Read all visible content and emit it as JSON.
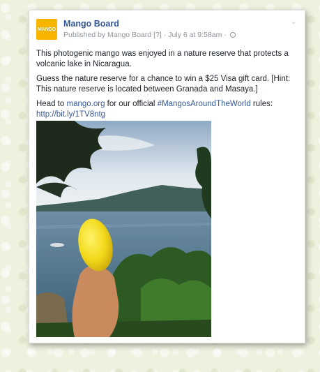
{
  "post": {
    "page_name": "Mango Board",
    "avatar_text": "MANGO",
    "published_by": "Published by Mango Board",
    "help_marker": "[?]",
    "separator": "·",
    "timestamp": "July 6 at 9:58am",
    "paragraph1": "This photogenic mango was enjoyed in a nature reserve that protects a volcanic lake in Nicaragua.",
    "paragraph2": "Guess the nature reserve for a chance to win a $25 Visa gift card. [Hint: This nature reserve is located between Granada and Masaya.]",
    "p3_prefix": "Head to ",
    "p3_link1": "mango.org",
    "p3_mid": " for our official ",
    "p3_hashtag": "#MangosAroundTheWorld",
    "p3_suffix": " rules:",
    "p3_shortlink": "http://bit.ly/1TV8ntg"
  },
  "colors": {
    "link": "#365899",
    "avatar_bg": "#f7b500",
    "meta_text": "#90949c"
  },
  "icons": {
    "globe": "globe-icon",
    "chevron": "chevron-down-icon"
  }
}
